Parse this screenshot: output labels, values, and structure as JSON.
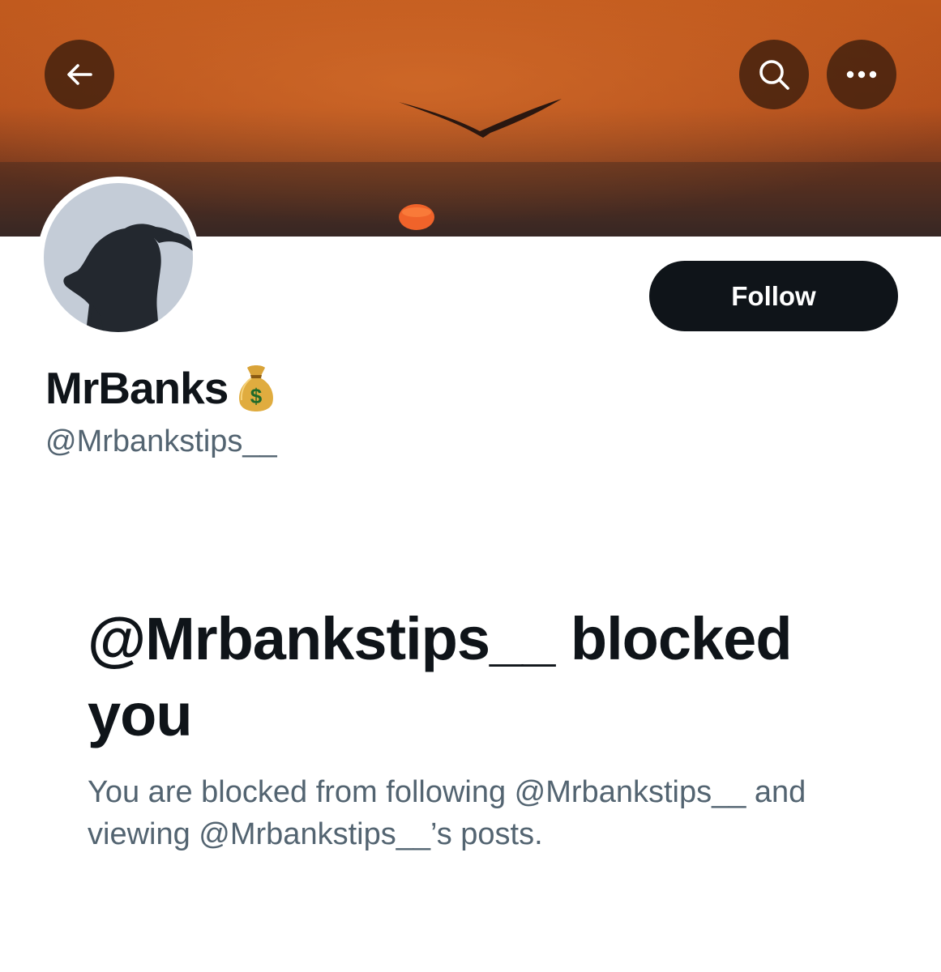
{
  "header": {
    "back_icon": "arrow-left-icon",
    "search_icon": "search-icon",
    "more_icon": "more-dots-icon",
    "button_bg": "#3e1e0e"
  },
  "banner": {
    "colors": [
      "#b8561e",
      "#8c3a14",
      "#3a2a28"
    ]
  },
  "profile": {
    "display_name": "MrBanks",
    "display_name_emoji": "money-bag-icon",
    "handle": "@Mrbankstips__",
    "follow_label": "Follow"
  },
  "blocked": {
    "title": "@Mrbankstips__ blocked you",
    "description": "You are blocked from following @Mrbankstips__ and viewing @Mrbankstips__’s posts."
  },
  "colors": {
    "primary_text": "#0f1419",
    "secondary_text": "#536471",
    "button_bg": "#0f1419",
    "button_text": "#ffffff"
  }
}
